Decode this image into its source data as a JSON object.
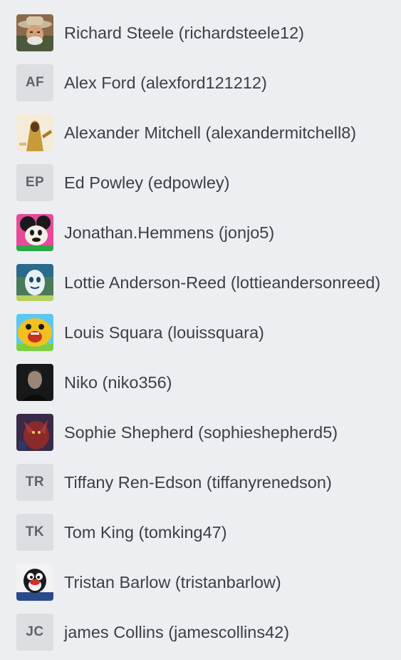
{
  "members": [
    {
      "name": "Richard Steele (richardsteele12)",
      "avatar": {
        "type": "image",
        "icon": "cowboy-portrait-avatar"
      }
    },
    {
      "name": "Alex Ford (alexford121212)",
      "avatar": {
        "type": "initials",
        "initials": "AF"
      }
    },
    {
      "name": "Alexander Mitchell (alexandermitchell8)",
      "avatar": {
        "type": "image",
        "icon": "hooded-figure-avatar"
      }
    },
    {
      "name": "Ed Powley (edpowley)",
      "avatar": {
        "type": "initials",
        "initials": "EP"
      }
    },
    {
      "name": "Jonathan.Hemmens (jonjo5)",
      "avatar": {
        "type": "image",
        "icon": "cartoon-mouse-avatar"
      }
    },
    {
      "name": "Lottie Anderson-Reed (lottieandersonreed)",
      "avatar": {
        "type": "image",
        "icon": "egg-character-avatar"
      }
    },
    {
      "name": "Louis Squara (louissquara)",
      "avatar": {
        "type": "image",
        "icon": "yellow-dog-avatar"
      }
    },
    {
      "name": "Niko (niko356)",
      "avatar": {
        "type": "image",
        "icon": "dark-portrait-avatar"
      }
    },
    {
      "name": "Sophie Shepherd (sophieshepherd5)",
      "avatar": {
        "type": "image",
        "icon": "red-creature-avatar"
      }
    },
    {
      "name": "Tiffany Ren-Edson (tiffanyrenedson)",
      "avatar": {
        "type": "initials",
        "initials": "TR"
      }
    },
    {
      "name": "Tom King (tomking47)",
      "avatar": {
        "type": "initials",
        "initials": "TK"
      }
    },
    {
      "name": "Tristan Barlow (tristanbarlow)",
      "avatar": {
        "type": "image",
        "icon": "penguin-avatar"
      }
    },
    {
      "name": "james Collins (jamescollins42)",
      "avatar": {
        "type": "initials",
        "initials": "JC"
      }
    }
  ],
  "colors": {
    "background": "#eceef1",
    "text": "#3c3f44",
    "initials_bg": "#dcdee2",
    "initials_text": "#5f6368"
  }
}
